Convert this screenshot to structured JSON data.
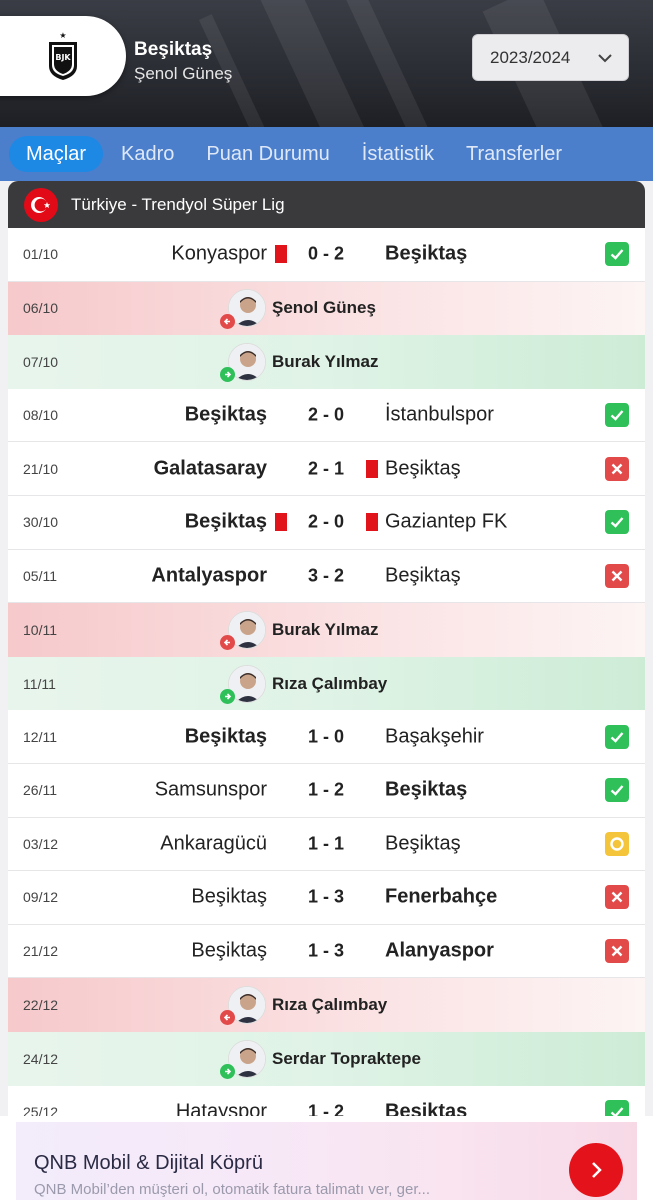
{
  "header": {
    "team_name": "Beşiktaş",
    "coach_name": "Şenol Güneş",
    "season": "2023/2024",
    "logo_icon": "besiktas-crest-icon"
  },
  "tabs": [
    "Maçlar",
    "Kadro",
    "Puan Durumu",
    "İstatistik",
    "Transferler"
  ],
  "active_tab": "Maçlar",
  "league": {
    "name": "Türkiye - Trendyol Süper Lig",
    "flag_icon": "turkey-flag-icon"
  },
  "rows": [
    {
      "kind": "match",
      "date": "01/10",
      "home": "Konyaspor",
      "score": "0 - 2",
      "away": "Beşiktaş",
      "winner": "away",
      "home_red": true,
      "away_red": false,
      "result": "win"
    },
    {
      "kind": "coach",
      "date": "06/10",
      "name": "Şenol Güneş",
      "change": "out"
    },
    {
      "kind": "coach",
      "date": "07/10",
      "name": "Burak Yılmaz",
      "change": "in"
    },
    {
      "kind": "match",
      "date": "08/10",
      "home": "Beşiktaş",
      "score": "2 - 0",
      "away": "İstanbulspor",
      "winner": "home",
      "home_red": false,
      "away_red": false,
      "result": "win"
    },
    {
      "kind": "match",
      "date": "21/10",
      "home": "Galatasaray",
      "score": "2 - 1",
      "away": "Beşiktaş",
      "winner": "home",
      "home_red": false,
      "away_red": true,
      "result": "loss"
    },
    {
      "kind": "match",
      "date": "30/10",
      "home": "Beşiktaş",
      "score": "2 - 0",
      "away": "Gaziantep FK",
      "winner": "home",
      "home_red": true,
      "away_red": true,
      "result": "win"
    },
    {
      "kind": "match",
      "date": "05/11",
      "home": "Antalyaspor",
      "score": "3 - 2",
      "away": "Beşiktaş",
      "winner": "home",
      "home_red": false,
      "away_red": false,
      "result": "loss"
    },
    {
      "kind": "coach",
      "date": "10/11",
      "name": "Burak Yılmaz",
      "change": "out"
    },
    {
      "kind": "coach",
      "date": "11/11",
      "name": "Rıza Çalımbay",
      "change": "in"
    },
    {
      "kind": "match",
      "date": "12/11",
      "home": "Beşiktaş",
      "score": "1 - 0",
      "away": "Başakşehir",
      "winner": "home",
      "home_red": false,
      "away_red": false,
      "result": "win"
    },
    {
      "kind": "match",
      "date": "26/11",
      "home": "Samsunspor",
      "score": "1 - 2",
      "away": "Beşiktaş",
      "winner": "away",
      "home_red": false,
      "away_red": false,
      "result": "win"
    },
    {
      "kind": "match",
      "date": "03/12",
      "home": "Ankaragücü",
      "score": "1 - 1",
      "away": "Beşiktaş",
      "winner": "none",
      "home_red": false,
      "away_red": false,
      "result": "draw"
    },
    {
      "kind": "match",
      "date": "09/12",
      "home": "Beşiktaş",
      "score": "1 - 3",
      "away": "Fenerbahçe",
      "winner": "away",
      "home_red": false,
      "away_red": false,
      "result": "loss"
    },
    {
      "kind": "match",
      "date": "21/12",
      "home": "Beşiktaş",
      "score": "1 - 3",
      "away": "Alanyaspor",
      "winner": "away",
      "home_red": false,
      "away_red": false,
      "result": "loss"
    },
    {
      "kind": "coach",
      "date": "22/12",
      "name": "Rıza Çalımbay",
      "change": "out"
    },
    {
      "kind": "coach",
      "date": "24/12",
      "name": "Serdar Topraktepe",
      "change": "in"
    },
    {
      "kind": "match",
      "date": "25/12",
      "home": "Hatayspor",
      "score": "1 - 2",
      "away": "Beşiktaş",
      "winner": "away",
      "home_red": false,
      "away_red": false,
      "result": "win"
    }
  ],
  "ad": {
    "title": "QNB Mobil & Dijital Köprü",
    "subtitle": "QNB Mobil’den müşteri ol, otomatik fatura talimatı ver, ger...",
    "button_icon": "chevron-right-icon"
  },
  "colors": {
    "tab_bar": "#4b7fcc",
    "tab_active": "#1e88e5",
    "win": "#2fc05a",
    "loss": "#e24a4a",
    "draw": "#f4c43a",
    "red_card": "#e1131b"
  }
}
